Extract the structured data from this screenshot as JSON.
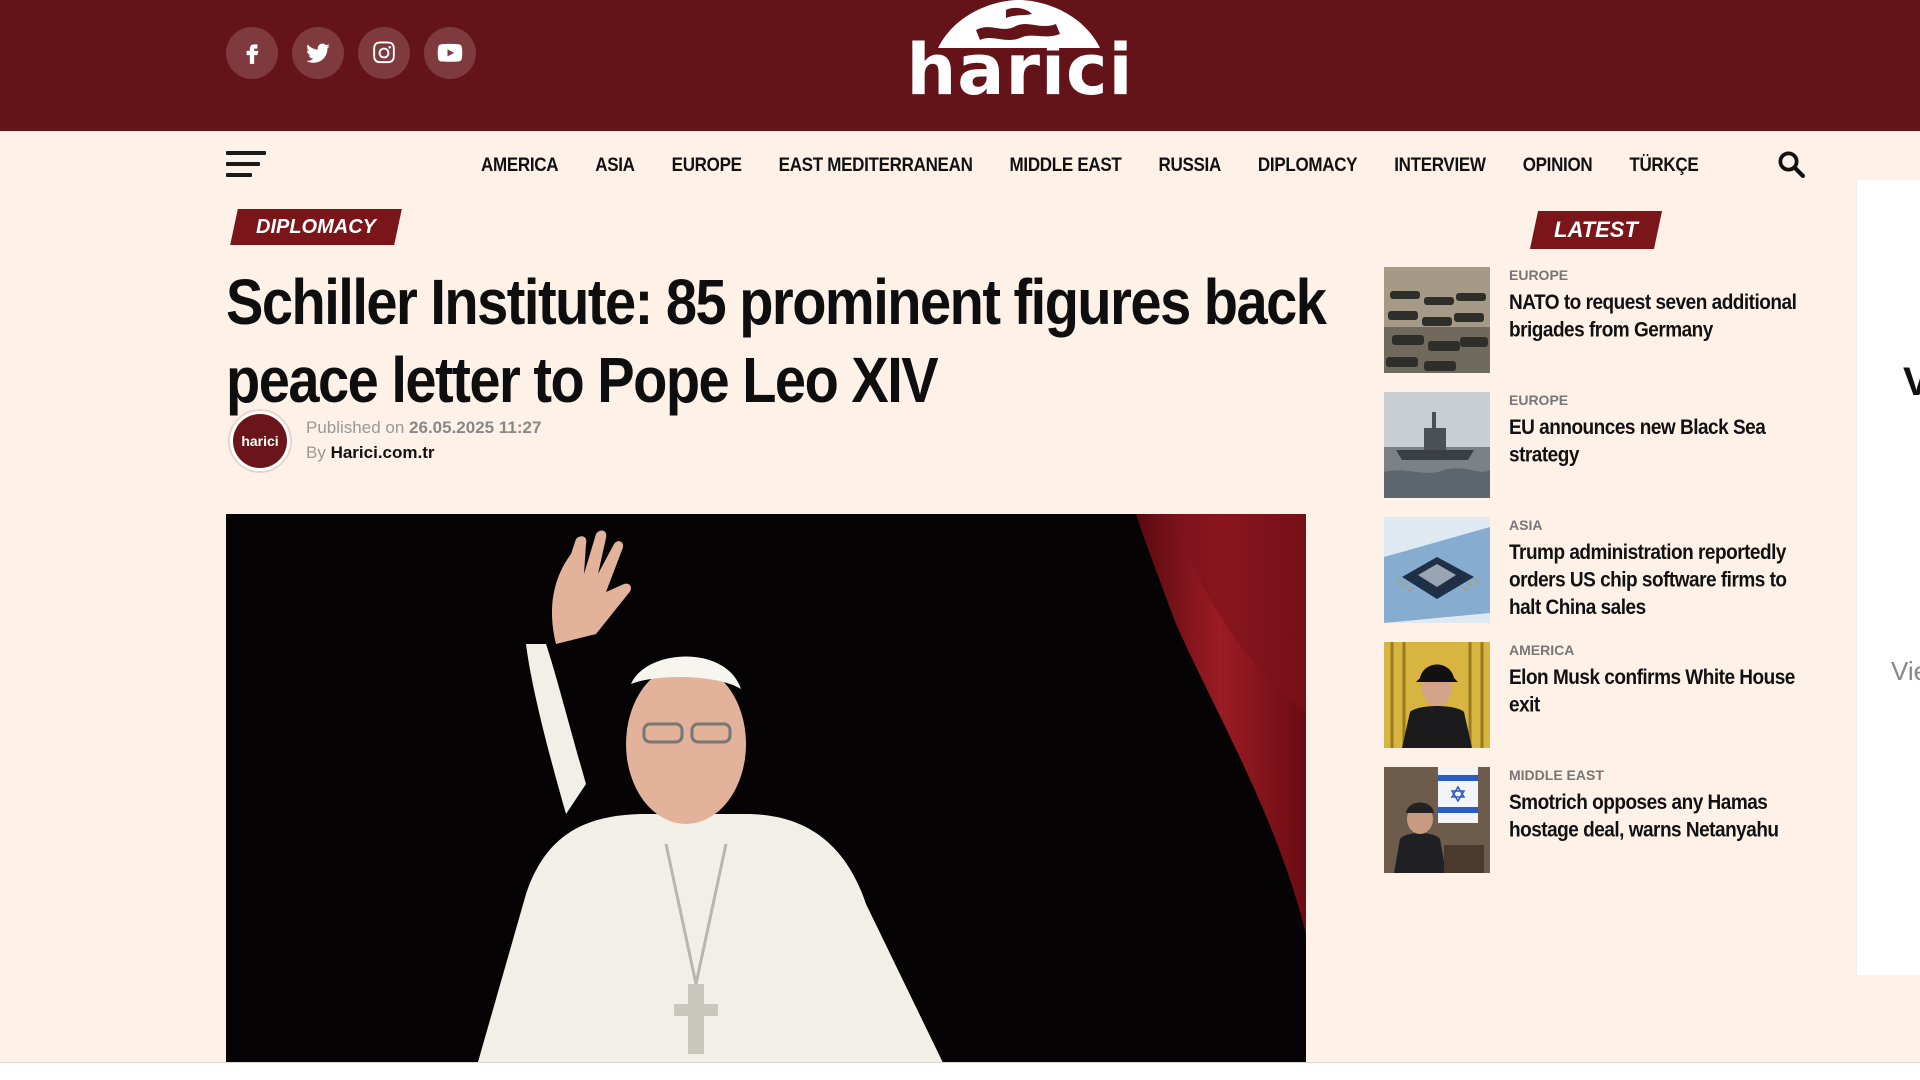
{
  "brand": {
    "logo_text": "harici",
    "colors": {
      "primary": "#641419",
      "accent": "#7a1519",
      "background": "#fdf1e8"
    }
  },
  "social": [
    {
      "name": "facebook-icon"
    },
    {
      "name": "twitter-icon"
    },
    {
      "name": "instagram-icon"
    },
    {
      "name": "youtube-icon"
    }
  ],
  "nav": {
    "items": [
      "AMERICA",
      "ASIA",
      "EUROPE",
      "EAST MEDITERRANEAN",
      "MIDDLE EAST",
      "RUSSIA",
      "DIPLOMACY",
      "INTERVIEW",
      "OPINION",
      "TÜRKÇE"
    ]
  },
  "article": {
    "category": "DIPLOMACY",
    "headline": "Schiller Institute: 85 prominent figures back peace letter to Pope Leo XIV",
    "published_label": "Published on",
    "published_date": "26.05.2025 11:27",
    "by_label": "By",
    "author": "Harici.com.tr",
    "avatar_text": "harici"
  },
  "sidebar": {
    "heading": "LATEST",
    "items": [
      {
        "category": "EUROPE",
        "title": "NATO to request seven additional brigades from Germany"
      },
      {
        "category": "EUROPE",
        "title": "EU announces new Black Sea strategy"
      },
      {
        "category": "ASIA",
        "title": "Trump administration reportedly orders US chip software firms to halt China sales"
      },
      {
        "category": "AMERICA",
        "title": "Elon Musk confirms White House exit"
      },
      {
        "category": "MIDDLE EAST",
        "title": "Smotrich opposes any Hamas hostage deal, warns Netanyahu"
      }
    ]
  },
  "right_panel": {
    "text_top": "V",
    "text_mid": "Vie"
  }
}
